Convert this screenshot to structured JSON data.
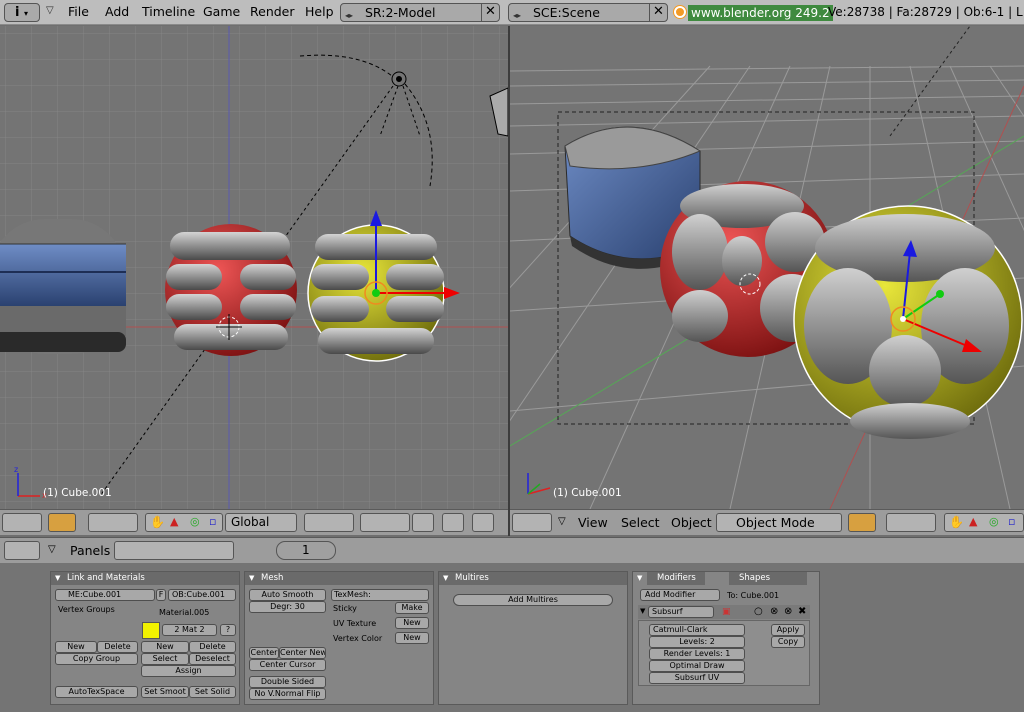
{
  "menus": [
    "File",
    "Add",
    "Timeline",
    "Game",
    "Render",
    "Help"
  ],
  "screen_field": "SR:2-Model",
  "scene_field": "SCE:Scene",
  "info": {
    "website": "www.blender.org 249.2",
    "stats": "Ve:28738 | Fa:28729 | Ob:6-1 | L"
  },
  "left_view": {
    "object_label": "(1) Cube.001",
    "orientation": "Global"
  },
  "right_view": {
    "object_label": "(1) Cube.001",
    "menus": [
      "View",
      "Select",
      "Object"
    ],
    "mode": "Object Mode"
  },
  "buttons": {
    "panels_label": "Panels",
    "frame": "1"
  },
  "link_materials": {
    "title": "Link and Materials",
    "me": "ME:Cube.001",
    "f_toggle": "F",
    "ob": "OB:Cube.001",
    "vertex_groups": "Vertex Groups",
    "material": "Material.005",
    "mat_index": "2 Mat 2",
    "mat_q": "?",
    "new": "New",
    "delete": "Delete",
    "copy_group": "Copy Group",
    "new2": "New",
    "delete2": "Delete",
    "select": "Select",
    "deselect": "Deselect",
    "assign": "Assign",
    "autotexspace": "AutoTexSpace",
    "set_smooth": "Set Smoot",
    "set_solid": "Set Solid"
  },
  "mesh": {
    "title": "Mesh",
    "auto_smooth": "Auto Smooth",
    "degr": "Degr: 30",
    "texmesh": "TexMesh:",
    "sticky": "Sticky",
    "make": "Make",
    "uv_texture": "UV Texture",
    "new1": "New",
    "vertex_color": "Vertex Color",
    "new2": "New",
    "center": "Center",
    "center_new": "Center New",
    "center_cursor": "Center Cursor",
    "double_sided": "Double Sided",
    "no_vnormal": "No V.Normal Flip"
  },
  "multires": {
    "title": "Multires",
    "add": "Add Multires"
  },
  "modifiers": {
    "tab1": "Modifiers",
    "tab2": "Shapes",
    "add_modifier": "Add Modifier",
    "to": "To: Cube.001",
    "name": "Subsurf",
    "type": "Catmull-Clark",
    "levels": "Levels: 2",
    "render_levels": "Render Levels: 1",
    "optimal_draw": "Optimal Draw",
    "subsurf_uv": "Subsurf UV",
    "apply": "Apply",
    "copy": "Copy"
  },
  "colors": {
    "red_sphere": "#c42020",
    "yellow_sphere": "#b9b81a",
    "blue_cube": "#3c5a98",
    "grid_line": "#888888",
    "mat_swatch": "#f2f200"
  }
}
